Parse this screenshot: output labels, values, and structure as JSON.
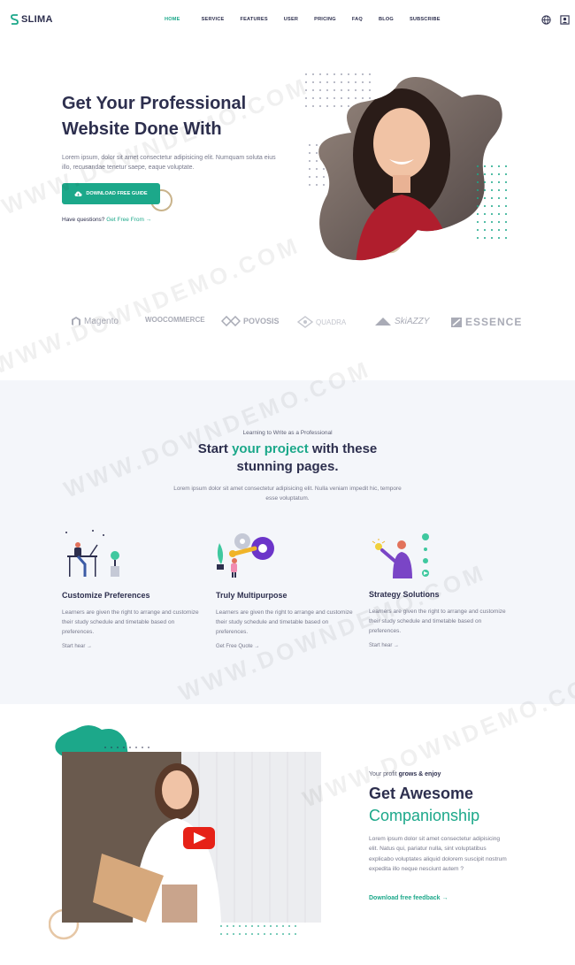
{
  "brand": {
    "name": "SLIMA"
  },
  "nav": {
    "items": [
      "HOME",
      "SERVICE",
      "FEATURES",
      "USER",
      "PRICING",
      "FAQ",
      "BLOG",
      "SUBSCRIBE"
    ],
    "active_index": 0
  },
  "header_icons": [
    "globe-icon",
    "user-icon"
  ],
  "hero": {
    "title_line1": "Get Your Professional",
    "title_line2": "Website Done With",
    "description": "Lorem ipsum, dolor sit amet consectetur adipisicing elit. Numquam soluta eius illo, recusandae tenetur saepe, eaque voluptate.",
    "button_label": "DOWNLOAD FREE GUIDE",
    "question": "Have questions?",
    "question_link": "Get Free From →"
  },
  "brands": [
    "Magento",
    "WOOCOMMERCE",
    "POVOSIS",
    "QUADRA",
    "SkiAZZY",
    "ESSENCE"
  ],
  "features_section": {
    "eyebrow": "Learning to Write as a Professional",
    "title_pre": "Start ",
    "title_highlight": "your project",
    "title_post": " with these stunning pages.",
    "description": "Lorem ipsum dolor sit amet consectetur adipisicing elit. Nulla veniam impedit hic, tempore esse voluptatum.",
    "items": [
      {
        "title": "Customize Preferences",
        "description": "Learners are given the right to arrange and customize their study schedule and timetable based on preferences.",
        "link": "Start hear →"
      },
      {
        "title": "Truly Multipurpose",
        "description": "Learners are given the right to arrange and customize their study schedule and timetable based on preferences.",
        "link": "Get Free Quote →"
      },
      {
        "title": "Strategy Solutions",
        "description": "Learners are given the right to arrange and customize their study schedule and timetable based on preferences.",
        "link": "Start hear →"
      }
    ]
  },
  "companion": {
    "eyebrow_pre": "Your profit ",
    "eyebrow_bold": "grows & enjoy",
    "title_line1": "Get Awesome",
    "title_line2": "Companionship",
    "description": "Lorem ipsum dolor sit amet consectetur adipisicing elit. Natus qui, pariatur nulla, sint voluptatibus explicabo voluptates aliquid dolorem suscipit nostrum expedita illo neque nesciunt autem ?",
    "link": "Download free feedback →"
  },
  "watermark": "WWW.DOWNDEMO.COM",
  "colors": {
    "accent": "#1ca88a",
    "dark": "#2d2f4e",
    "muted": "#77798c",
    "section_bg": "#f4f6fa",
    "youtube": "#e62117"
  }
}
